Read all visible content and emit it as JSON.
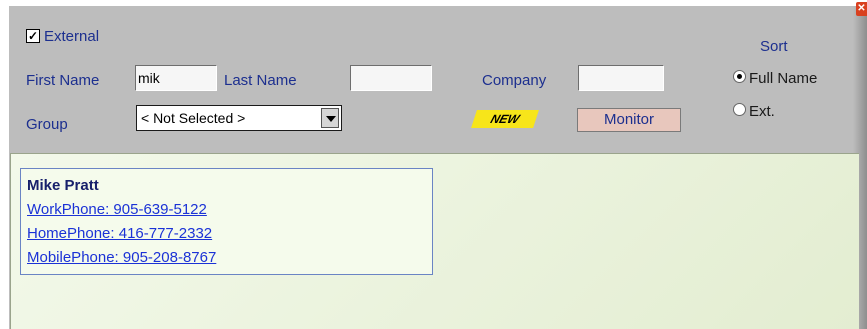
{
  "filters": {
    "external_label": "External",
    "external_checked": true,
    "first_name_label": "First Name",
    "first_name_value": "mik",
    "last_name_label": "Last Name",
    "last_name_value": "",
    "company_label": "Company",
    "company_value": "",
    "group_label": "Group",
    "group_selected": "< Not Selected >",
    "new_badge": "NEW",
    "monitor_button": "Monitor"
  },
  "sort": {
    "title": "Sort",
    "options": [
      {
        "label": "Full Name",
        "selected": true
      },
      {
        "label": "Ext.",
        "selected": false
      }
    ]
  },
  "results": [
    {
      "name": "Mike Pratt",
      "work_phone": "WorkPhone: 905-639-5122",
      "home_phone": "HomePhone: 416-777-2332",
      "mobile_phone": "MobilePhone: 905-208-8767"
    }
  ],
  "icons": {
    "close": "close-icon",
    "dropdown": "chevron-down-icon"
  },
  "colors": {
    "label": "#1c2f8f",
    "link": "#1b32d6",
    "badge": "#f7e51a",
    "panel": "#bdbdbd"
  }
}
